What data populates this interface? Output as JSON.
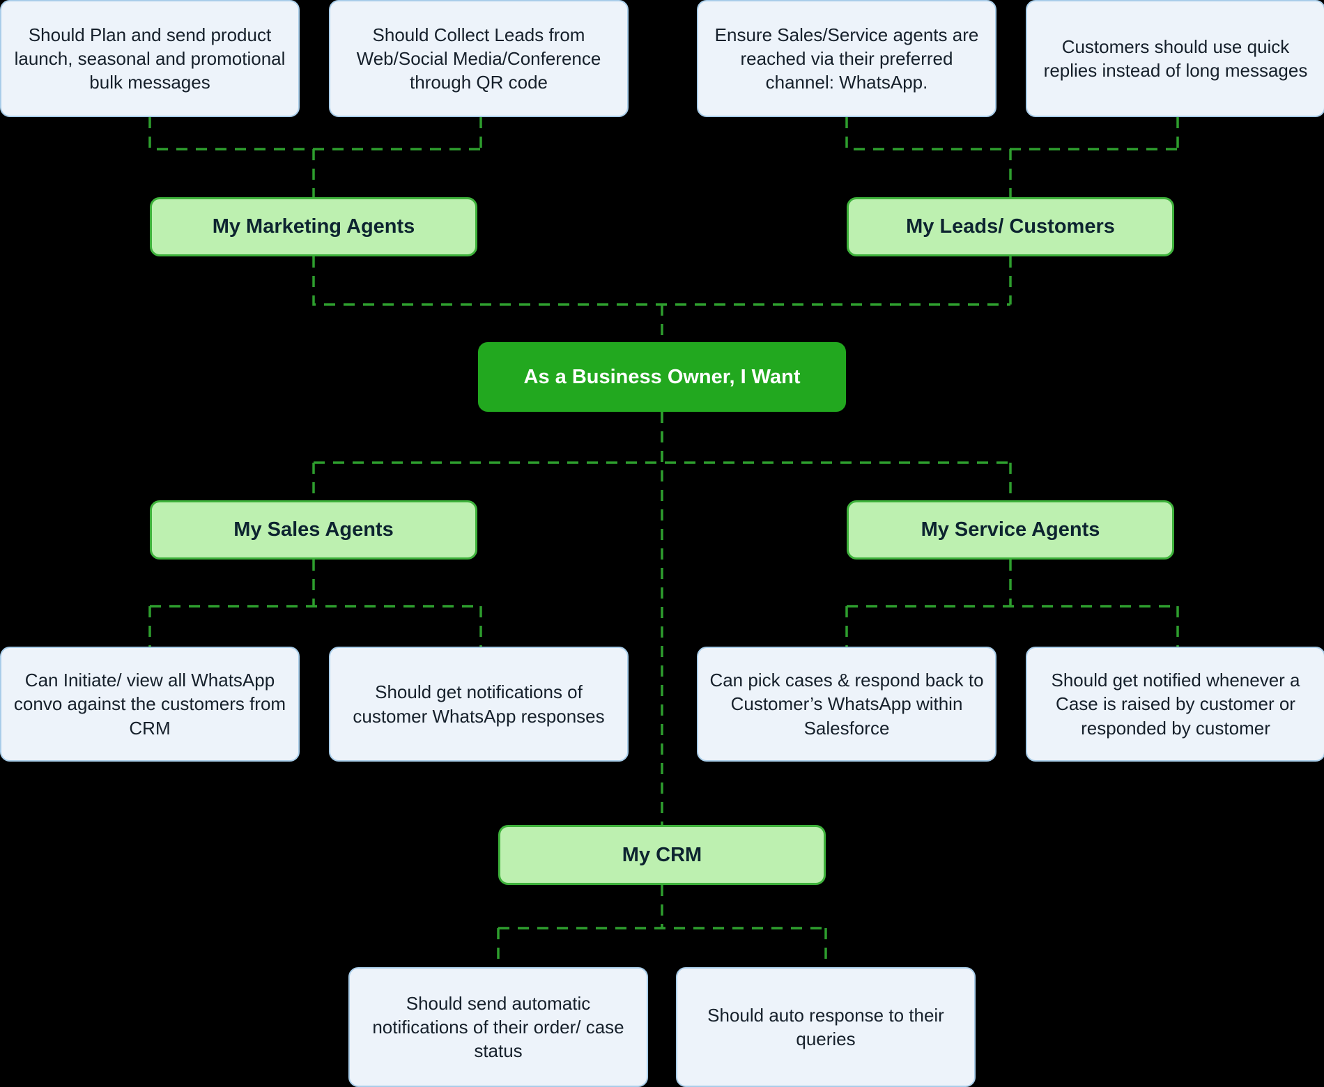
{
  "diagram": {
    "title": "As a Business Owner, I Want",
    "background": "#000000",
    "colors": {
      "root_fill": "#22a81f",
      "root_text": "#ffffff",
      "entity_fill": "#bdf0b0",
      "entity_border": "#3eb23b",
      "entity_text": "#0d2430",
      "requirement_fill": "#edf3fa",
      "requirement_border": "#a9cde9",
      "requirement_text": "#16202b",
      "connector": "#2e9e2e"
    },
    "root": {
      "label": "As a Business Owner, I Want"
    },
    "entities": {
      "marketing_agents": "My Marketing Agents",
      "leads_customers": "My Leads/ Customers",
      "sales_agents": "My Sales Agents",
      "service_agents": "My Service Agents",
      "crm": "My CRM"
    },
    "requirements": {
      "marketing_1": "Should Plan and send product launch, seasonal and promotional bulk messages",
      "marketing_2": "Should Collect Leads from Web/Social Media/Conference through QR code",
      "leads_1": "Ensure Sales/Service agents are reached via their preferred channel: WhatsApp.",
      "leads_2": "Customers should use quick replies instead of long messages",
      "sales_1": "Can Initiate/ view all WhatsApp convo against the customers from CRM",
      "sales_2": "Should get notifications of customer WhatsApp responses",
      "service_1": "Can pick cases & respond back to Customer’s WhatsApp within Salesforce",
      "service_2": "Should get notified whenever a Case is raised by customer or responded by customer",
      "crm_1": "Should send automatic notifications of their order/ case status",
      "crm_2": "Should auto response to their queries"
    }
  }
}
